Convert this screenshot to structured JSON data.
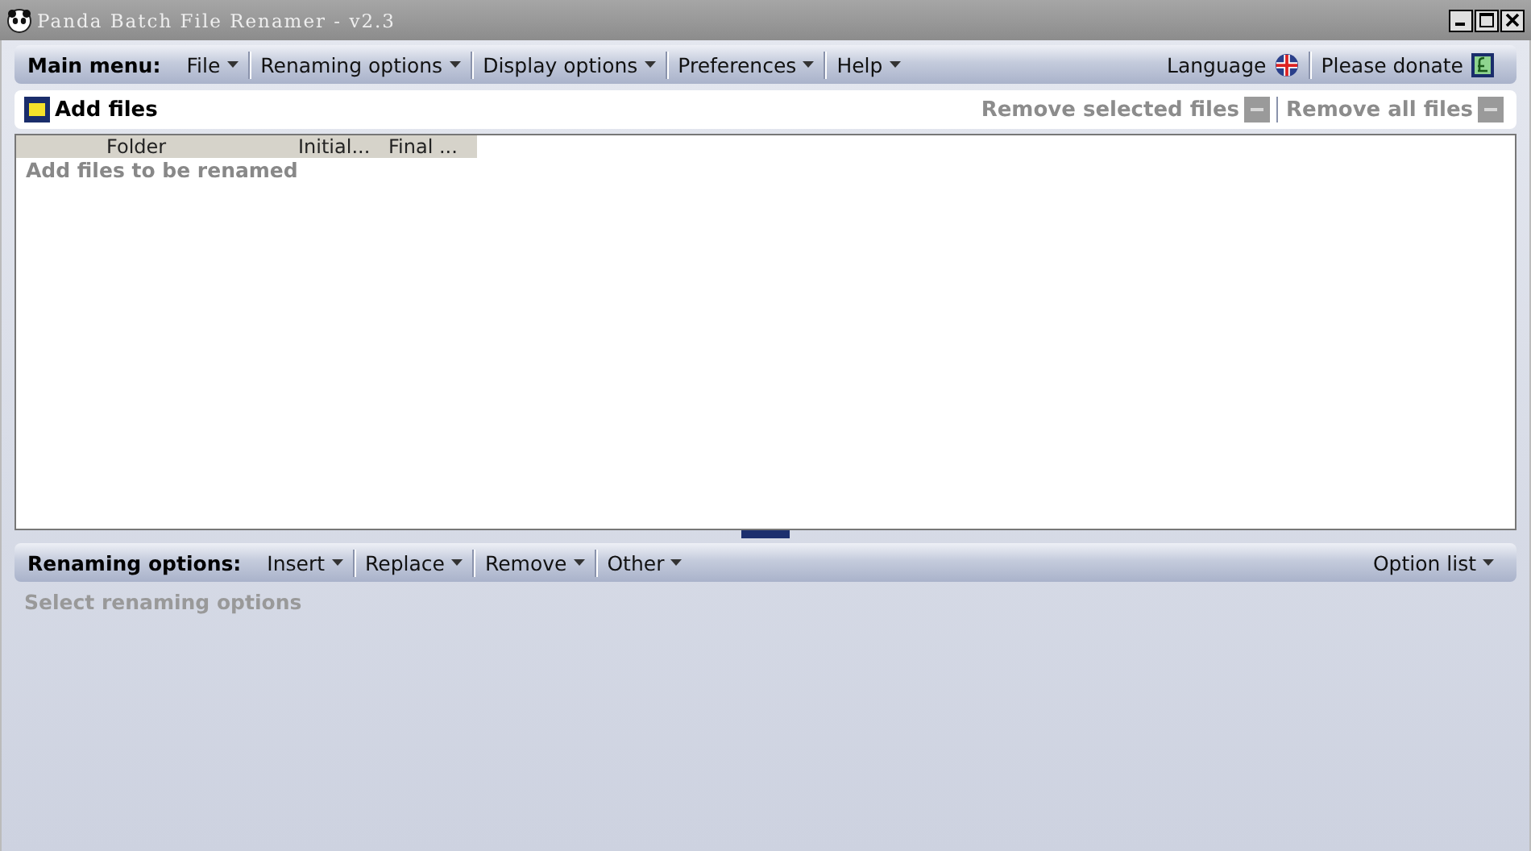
{
  "window": {
    "title": "Panda Batch File Renamer - v2.3"
  },
  "main_menu": {
    "label": "Main menu:",
    "items": [
      "File",
      "Renaming options",
      "Display options",
      "Preferences",
      "Help"
    ],
    "language": "Language",
    "donate": "Please donate"
  },
  "toolbar": {
    "add": "Add files",
    "remove_buttons": [
      {
        "label": "Remove selected files",
        "disabled": true
      },
      {
        "label": "Remove all files",
        "disabled": true
      }
    ]
  },
  "table": {
    "columns": [
      "Folder",
      "Initial...",
      "Final ..."
    ],
    "empty_text": "Add files to be renamed"
  },
  "renaming_bar": {
    "label": "Renaming options:",
    "items": [
      "Insert",
      "Replace",
      "Remove",
      "Other"
    ],
    "option_list": "Option list"
  },
  "options_hint": "Select renaming options"
}
